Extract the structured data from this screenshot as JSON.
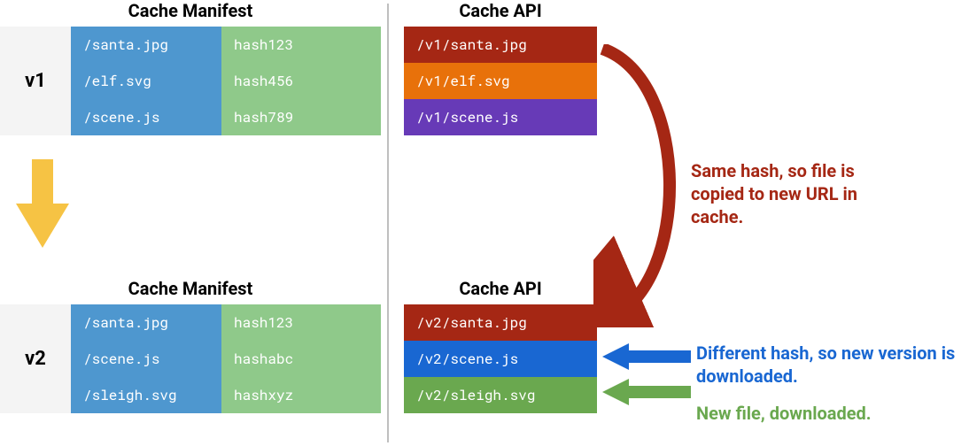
{
  "titles": {
    "manifest": "Cache Manifest",
    "api": "Cache API"
  },
  "v1": {
    "label": "v1",
    "files": [
      "/santa.jpg",
      "/elf.svg",
      "/scene.js"
    ],
    "hashes": [
      "hash123",
      "hash456",
      "hash789"
    ]
  },
  "v2": {
    "label": "v2",
    "files": [
      "/santa.jpg",
      "/scene.js",
      "/sleigh.svg"
    ],
    "hashes": [
      "hash123",
      "hashabc",
      "hashxyz"
    ]
  },
  "api_v1": [
    "/v1/santa.jpg",
    "/v1/elf.svg",
    "/v1/scene.js"
  ],
  "api_v2": [
    "/v2/santa.jpg",
    "/v2/scene.js",
    "/v2/sleigh.svg"
  ],
  "annotations": {
    "same_hash": "Same hash, so file is copied to new URL in cache.",
    "diff_hash": "Different hash, so new version is downloaded.",
    "new_file": "New file, downloaded."
  },
  "colors": {
    "blue": "#4e97cf",
    "green": "#8fc98a",
    "brown": "#a52714",
    "orange": "#e8710a",
    "purple": "#673ab7",
    "darkblue": "#1967d2",
    "darkgreen": "#6aa84f",
    "yellow": "#f6c344"
  }
}
